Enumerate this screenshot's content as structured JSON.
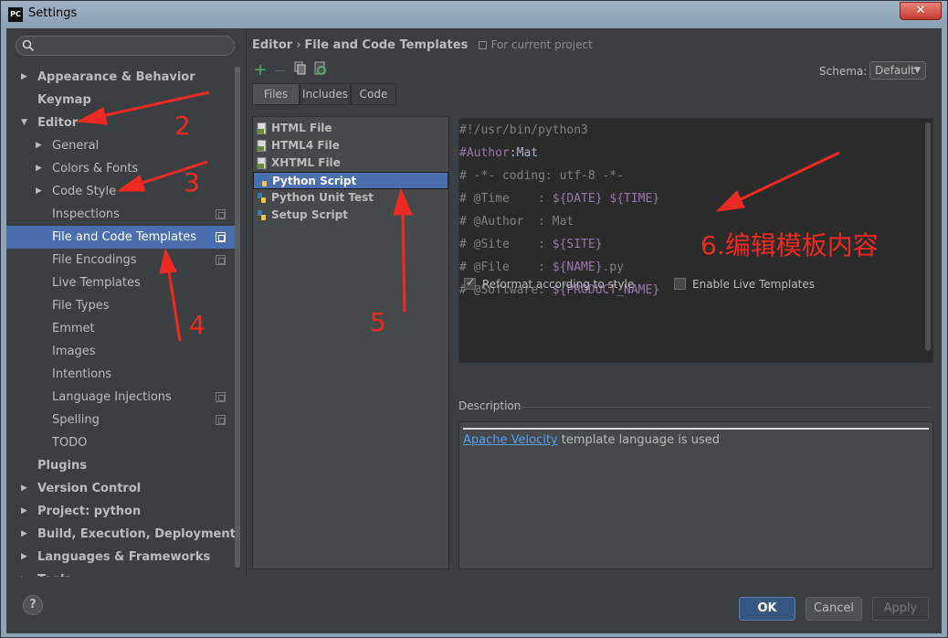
{
  "window": {
    "title": "Settings",
    "app_icon_text": "PC",
    "close_label": "✕"
  },
  "sidebar": {
    "search_placeholder": "",
    "items": [
      {
        "label": "Appearance & Behavior",
        "arrow": "▶",
        "level": 0,
        "bold": true
      },
      {
        "label": "Keymap",
        "arrow": "",
        "level": 0,
        "bold": true
      },
      {
        "label": "Editor",
        "arrow": "▼",
        "level": 0,
        "bold": true
      },
      {
        "label": "General",
        "arrow": "▶",
        "level": 1
      },
      {
        "label": "Colors & Fonts",
        "arrow": "▶",
        "level": 1
      },
      {
        "label": "Code Style",
        "arrow": "▶",
        "level": 1
      },
      {
        "label": "Inspections",
        "arrow": "",
        "level": 1,
        "proj": true
      },
      {
        "label": "File and Code Templates",
        "arrow": "",
        "level": 1,
        "proj": true,
        "selected": true
      },
      {
        "label": "File Encodings",
        "arrow": "",
        "level": 1,
        "proj": true
      },
      {
        "label": "Live Templates",
        "arrow": "",
        "level": 1
      },
      {
        "label": "File Types",
        "arrow": "",
        "level": 1
      },
      {
        "label": "Emmet",
        "arrow": "",
        "level": 1
      },
      {
        "label": "Images",
        "arrow": "",
        "level": 1
      },
      {
        "label": "Intentions",
        "arrow": "",
        "level": 1
      },
      {
        "label": "Language Injections",
        "arrow": "",
        "level": 1,
        "proj": true
      },
      {
        "label": "Spelling",
        "arrow": "",
        "level": 1,
        "proj": true
      },
      {
        "label": "TODO",
        "arrow": "",
        "level": 1
      },
      {
        "label": "Plugins",
        "arrow": "",
        "level": 0,
        "bold": true
      },
      {
        "label": "Version Control",
        "arrow": "▶",
        "level": 0,
        "bold": true
      },
      {
        "label": "Project: python",
        "arrow": "▶",
        "level": 0,
        "bold": true
      },
      {
        "label": "Build, Execution, Deployment",
        "arrow": "▶",
        "level": 0,
        "bold": true
      },
      {
        "label": "Languages & Frameworks",
        "arrow": "▶",
        "level": 0,
        "bold": true
      },
      {
        "label": "Tools",
        "arrow": "▶",
        "level": 0,
        "bold": true
      }
    ]
  },
  "breadcrumb": {
    "parent": "Editor",
    "separator": "›",
    "current": "File and Code Templates",
    "scope": "For current project"
  },
  "toolbar": {
    "add": "+",
    "remove": "—"
  },
  "schema": {
    "label": "Schema:",
    "value": "Default"
  },
  "tabs": [
    "Files",
    "Includes",
    "Code"
  ],
  "files": [
    {
      "label": "HTML File"
    },
    {
      "label": "HTML4 File"
    },
    {
      "label": "XHTML File"
    },
    {
      "label": "Python Script",
      "selected": true
    },
    {
      "label": "Python Unit Test"
    },
    {
      "label": "Setup Script"
    }
  ],
  "code": {
    "l1": "#!/usr/bin/python3",
    "l2a": "#Author",
    "l2b": ":Mat",
    "l3": "# -*- coding: utf-8 -*-",
    "l4a": "# @Time    : ",
    "l4b": "${DATE}",
    "l4c": " ",
    "l4d": "${TIME}",
    "l5": "# @Author  : Mat",
    "l6a": "# @Site    : ",
    "l6b": "${SITE}",
    "l7a": "# @File    : ",
    "l7b": "${NAME}",
    "l7c": ".py",
    "l8a": "# @Software: ",
    "l8b": "${PRODUCT_NAME}"
  },
  "options": {
    "reformat": {
      "label": "Reformat according to style",
      "checked": true
    },
    "live": {
      "label": "Enable Live Templates",
      "checked": false
    }
  },
  "description": {
    "label": "Description",
    "link": "Apache Velocity",
    "text": " template language is used"
  },
  "footer": {
    "help": "?",
    "ok": "OK",
    "cancel": "Cancel",
    "apply": "Apply"
  },
  "annotations": {
    "n2": "2",
    "n3": "3",
    "n4": "4",
    "n5": "5",
    "n6": "6.编辑模板内容"
  },
  "colors": {
    "accent": "#4b6eaf",
    "annotation": "#ef2a22"
  }
}
